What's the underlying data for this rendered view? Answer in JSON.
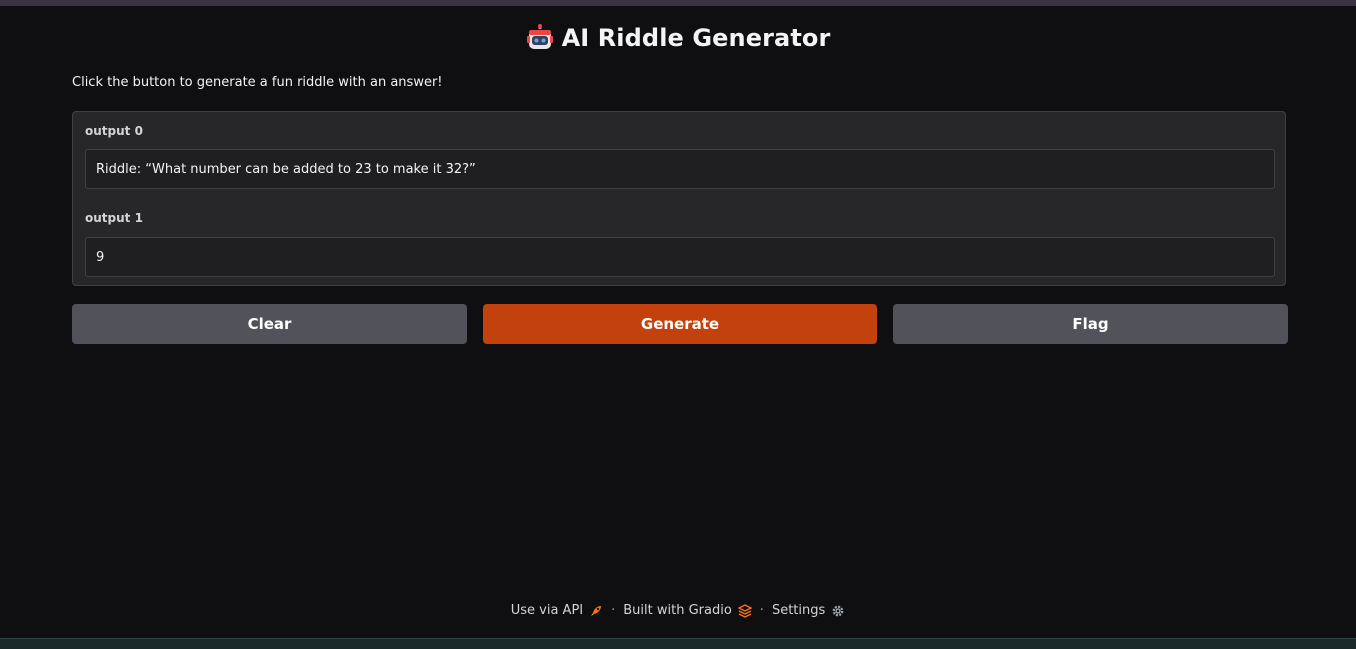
{
  "app": {
    "title": "AI Riddle Generator",
    "title_icon": "robot-icon",
    "description": "Click the button to generate a fun riddle with an answer!"
  },
  "outputs": [
    {
      "label": "output 0",
      "value": "Riddle: “What number can be added to 23 to make it 32?”"
    },
    {
      "label": "output 1",
      "value": "9"
    }
  ],
  "buttons": {
    "clear": "Clear",
    "generate": "Generate",
    "flag": "Flag"
  },
  "footer": {
    "api": "Use via API",
    "api_icon": "rocket-icon",
    "built": "Built with Gradio",
    "built_icon": "gradio-logo-icon",
    "settings": "Settings",
    "settings_icon": "gear-icon",
    "separator": "·"
  },
  "colors": {
    "background": "#0f0f11",
    "panel": "#27272a",
    "primary_button": "#c2410c",
    "secondary_button": "#52525b"
  }
}
